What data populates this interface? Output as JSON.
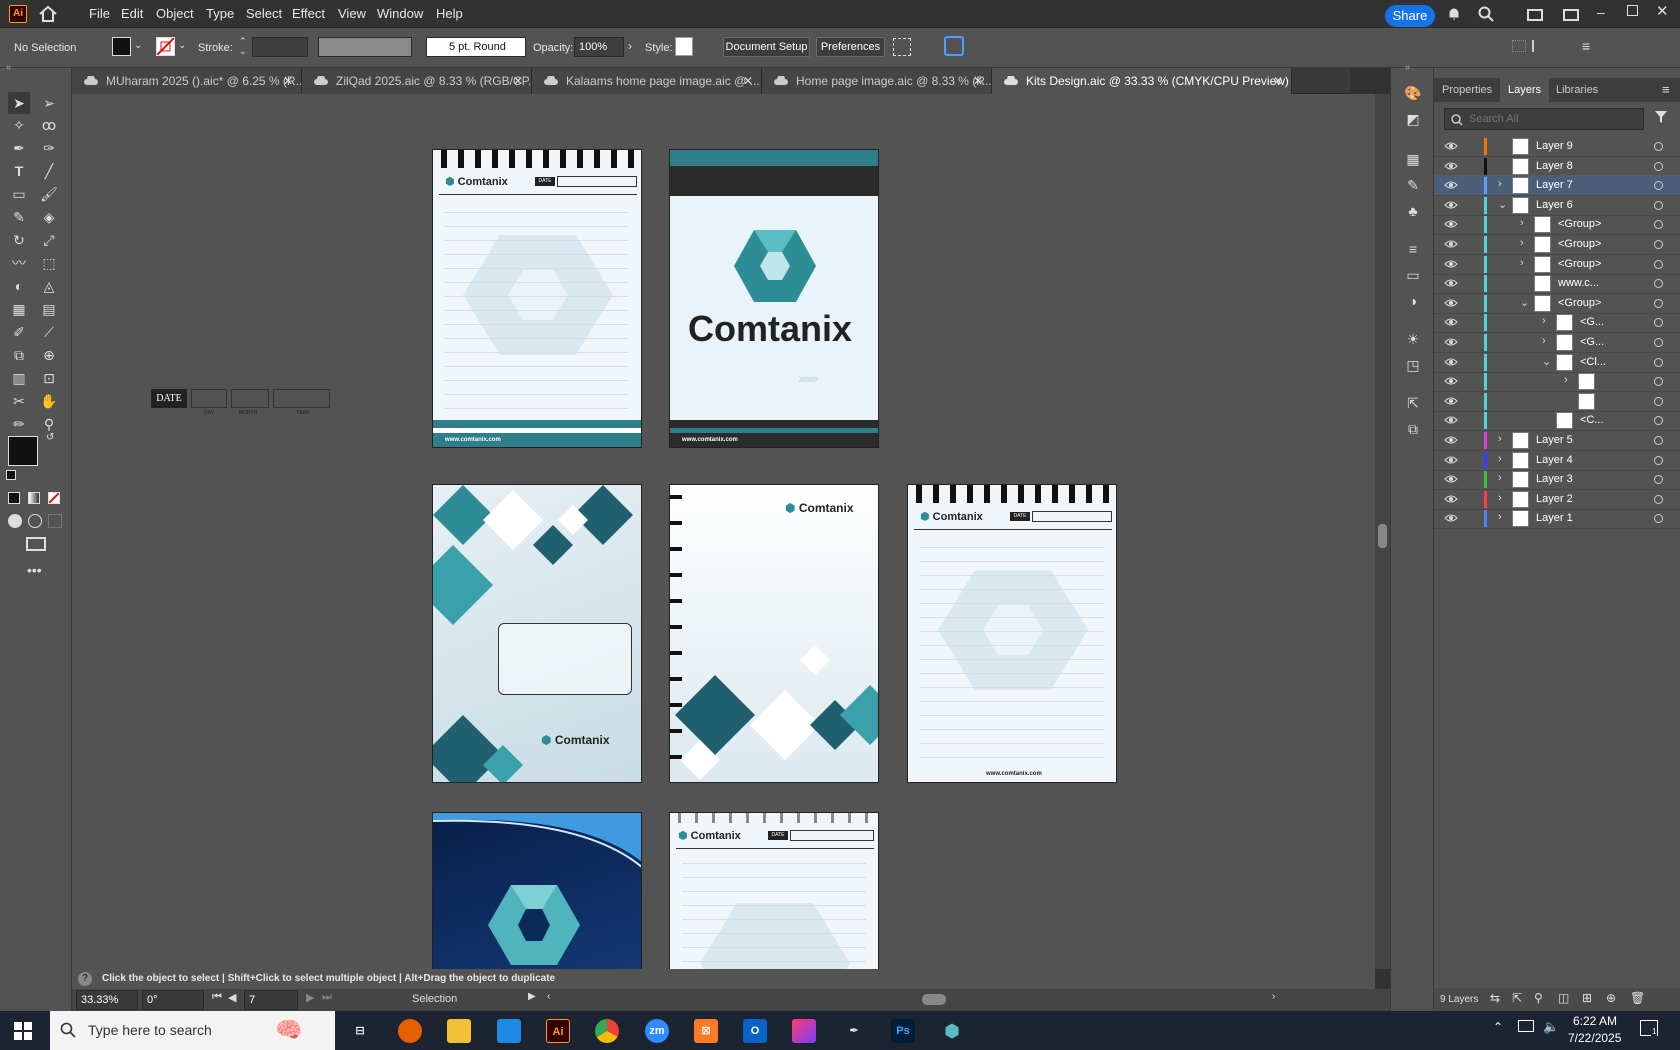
{
  "menubar": {
    "app_logo": "Ai",
    "items": [
      "File",
      "Edit",
      "Object",
      "Type",
      "Select",
      "Effect",
      "View",
      "Window",
      "Help"
    ],
    "share_label": "Share"
  },
  "control_bar": {
    "selection": "No Selection",
    "stroke_label": "Stroke:",
    "brush": "5 pt. Round",
    "opacity_label": "Opacity:",
    "opacity_value": "100%",
    "style_label": "Style:",
    "document_setup": "Document Setup",
    "preferences": "Preferences"
  },
  "tabs": [
    {
      "label": "MUharam 2025 ().aic* @ 6.25 % (R...",
      "active": false
    },
    {
      "label": "ZilQad 2025.aic @ 8.33 % (RGB/CP...",
      "active": false
    },
    {
      "label": "Kalaams home page image.aic @ ...",
      "active": false
    },
    {
      "label": "Home page image.aic @ 8.33 % (R...",
      "active": false
    },
    {
      "label": "Kits Design.aic @ 33.33 % (CMYK/CPU Preview)",
      "active": true
    }
  ],
  "layers_panel": {
    "tabs": [
      "Properties",
      "Layers",
      "Libraries"
    ],
    "active_tab": "Layers",
    "search_placeholder": "Search All",
    "rows": [
      {
        "name": "Layer 9",
        "indent": 0,
        "chevron": "",
        "color": "#f07800",
        "selected": false
      },
      {
        "name": "Layer 8",
        "indent": 0,
        "chevron": "",
        "color": "#111111",
        "selected": false
      },
      {
        "name": "Layer 7",
        "indent": 0,
        "chevron": "›",
        "color": "#5aa0ff",
        "selected": true
      },
      {
        "name": "Layer 6",
        "indent": 0,
        "chevron": "⌄",
        "color": "#4fd6d0",
        "selected": false
      },
      {
        "name": "<Group>",
        "indent": 1,
        "chevron": "›",
        "color": "#4fd6d0",
        "selected": false
      },
      {
        "name": "<Group>",
        "indent": 1,
        "chevron": "›",
        "color": "#4fd6d0",
        "selected": false
      },
      {
        "name": "<Group>",
        "indent": 1,
        "chevron": "›",
        "color": "#4fd6d0",
        "selected": false
      },
      {
        "name": "www.c...",
        "indent": 1,
        "chevron": "",
        "color": "#4fd6d0",
        "selected": false
      },
      {
        "name": "<Group>",
        "indent": 1,
        "chevron": "⌄",
        "color": "#4fd6d0",
        "selected": false
      },
      {
        "name": "<G...",
        "indent": 2,
        "chevron": "›",
        "color": "#4fd6d0",
        "selected": false
      },
      {
        "name": "<G...",
        "indent": 2,
        "chevron": "›",
        "color": "#4fd6d0",
        "selected": false
      },
      {
        "name": "<Cl...",
        "indent": 2,
        "chevron": "⌄",
        "color": "#4fd6d0",
        "selected": false
      },
      {
        "name": "",
        "indent": 3,
        "chevron": "›",
        "color": "#4fd6d0",
        "selected": false
      },
      {
        "name": "",
        "indent": 3,
        "chevron": "",
        "color": "#4fd6d0",
        "selected": false
      },
      {
        "name": "<C...",
        "indent": 2,
        "chevron": "",
        "color": "#4fd6d0",
        "selected": false
      },
      {
        "name": "Layer 5",
        "indent": 0,
        "chevron": "›",
        "color": "#e040e0",
        "selected": false
      },
      {
        "name": "Layer 4",
        "indent": 0,
        "chevron": "›",
        "color": "#3a3aff",
        "selected": false
      },
      {
        "name": "Layer 3",
        "indent": 0,
        "chevron": "›",
        "color": "#3ac03a",
        "selected": false
      },
      {
        "name": "Layer 2",
        "indent": 0,
        "chevron": "›",
        "color": "#ff4040",
        "selected": false
      },
      {
        "name": "Layer 1",
        "indent": 0,
        "chevron": "›",
        "color": "#5080ff",
        "selected": false
      }
    ],
    "footer_count": "9 Layers"
  },
  "status": {
    "hint": "Click the object to select  |  Shift+Click to select multiple object  |  Alt+Drag the object to duplicate",
    "zoom": "33.33%",
    "rotation": "0°",
    "artboard": "7",
    "tool": "Selection"
  },
  "artwork": {
    "brand": "Comtanix",
    "url": "www.comtanix.com",
    "date_label": "DATE",
    "day_label": "DAY",
    "month_label": "MONTH",
    "year_label": "YEAR"
  },
  "taskbar": {
    "search_placeholder": "Type here to search",
    "time": "6:22 AM",
    "date": "7/22/2025",
    "notif_count": "1"
  },
  "colors": {
    "accent": "#1473e6",
    "teal": "#2e8c96",
    "dark_navy": "#0e2a5a"
  }
}
